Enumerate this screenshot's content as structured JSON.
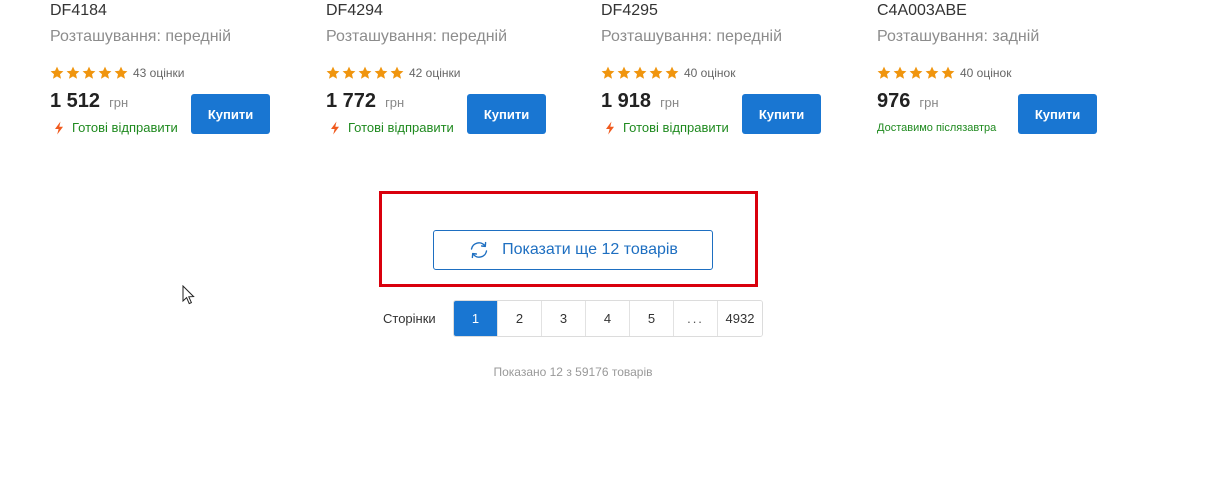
{
  "products": [
    {
      "code": "DF4184",
      "subtitle": "Розташування: передній",
      "rating_value": 5,
      "reviews": "43 оцінки",
      "price": "1 512",
      "currency": "грн",
      "shipping": "Готові відправити",
      "shipping_icon": "bolt-icon",
      "buy_label": "Купити"
    },
    {
      "code": "DF4294",
      "subtitle": "Розташування: передній",
      "rating_value": 5,
      "reviews": "42 оцінки",
      "price": "1 772",
      "currency": "грн",
      "shipping": "Готові відправити",
      "shipping_icon": "bolt-icon",
      "buy_label": "Купити"
    },
    {
      "code": "DF4295",
      "subtitle": "Розташування: передній",
      "rating_value": 5,
      "reviews": "40 оцінок",
      "price": "1 918",
      "currency": "грн",
      "shipping": "Готові відправити",
      "shipping_icon": "bolt-icon",
      "buy_label": "Купити"
    },
    {
      "code": "C4A003ABE",
      "subtitle": "Розташування: задній",
      "rating_value": 5,
      "reviews": "40 оцінок",
      "price": "976",
      "currency": "грн",
      "shipping": "Доставимо післязавтра",
      "shipping_icon": "",
      "buy_label": "Купити"
    }
  ],
  "show_more": {
    "label": "Показати ще 12 товарів",
    "icon": "refresh-icon"
  },
  "pagination": {
    "label": "Сторінки",
    "pages": [
      "1",
      "2",
      "3",
      "4",
      "5",
      "...",
      "4932"
    ],
    "current": "1"
  },
  "summary": "Показано 12 з 59176 товарів",
  "colors": {
    "accent": "#1976d2",
    "star": "#f0950e",
    "shipping_text": "#1f8a1f",
    "bolt": "#f05a1e",
    "highlight": "#d9000d"
  }
}
